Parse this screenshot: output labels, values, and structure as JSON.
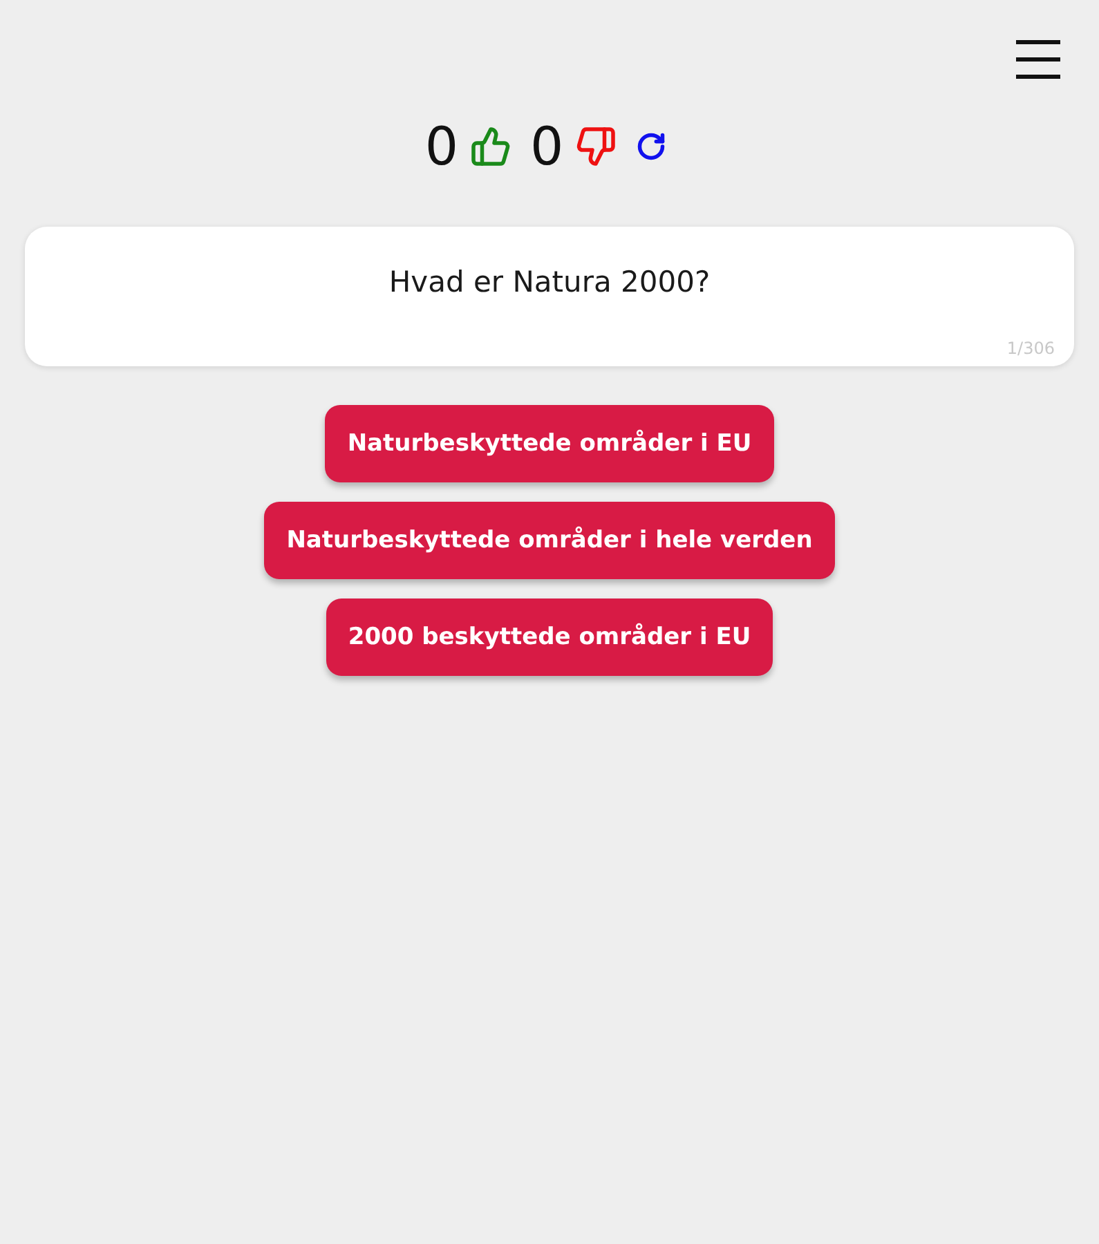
{
  "score": {
    "correct": "0",
    "wrong": "0"
  },
  "question": {
    "text": "Hvad er Natura 2000?",
    "counter": "1/306"
  },
  "answers": [
    {
      "label": "Naturbeskyttede områder i EU"
    },
    {
      "label": "Naturbeskyttede områder i hele verden"
    },
    {
      "label": "2000 beskyttede områder i EU"
    }
  ]
}
